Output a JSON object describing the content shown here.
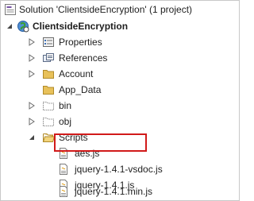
{
  "tree": {
    "solution": {
      "label": "Solution 'ClientsideEncryption' (1 project)",
      "icon": "solution-icon"
    },
    "project": {
      "label": "ClientsideEncryption",
      "icon": "web-project-icon",
      "expanded": true
    },
    "items": [
      {
        "key": "properties",
        "label": "Properties",
        "icon": "properties-icon",
        "expandable": true
      },
      {
        "key": "references",
        "label": "References",
        "icon": "references-icon",
        "expandable": true
      },
      {
        "key": "account",
        "label": "Account",
        "icon": "folder-icon",
        "expandable": true
      },
      {
        "key": "app_data",
        "label": "App_Data",
        "icon": "folder-icon",
        "expandable": false
      },
      {
        "key": "bin",
        "label": "bin",
        "icon": "folder-outline-icon",
        "expandable": true
      },
      {
        "key": "obj",
        "label": "obj",
        "icon": "folder-outline-icon",
        "expandable": true
      },
      {
        "key": "scripts",
        "label": "Scripts",
        "icon": "folder-open-icon",
        "expanded": true
      },
      {
        "key": "aes",
        "label": "aes.js",
        "icon": "js-file-icon",
        "highlighted": true
      },
      {
        "key": "jq_vsdoc",
        "label": "jquery-1.4.1-vsdoc.js",
        "icon": "js-file-icon"
      },
      {
        "key": "jq",
        "label": "jquery-1.4.1.js",
        "icon": "js-file-icon"
      },
      {
        "key": "jq_min",
        "label": "jquery-1.4.1.min.js",
        "icon": "js-file-icon"
      }
    ]
  },
  "colors": {
    "highlight_border": "#d11a1a",
    "folder": "#e8c15a"
  }
}
